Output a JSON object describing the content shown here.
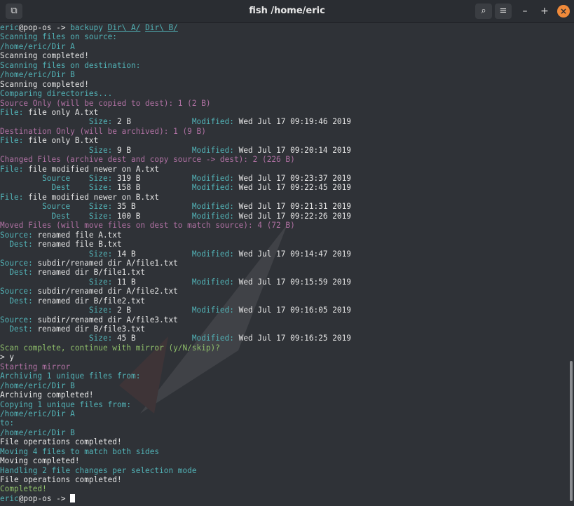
{
  "window": {
    "title": "fish /home/eric",
    "buttons": {
      "new_tab": "⧉",
      "search": "⌕",
      "menu": "≡",
      "minimize": "–",
      "maximize": "+",
      "close": "×"
    }
  },
  "terminal": {
    "lines": [
      [
        [
          "eric",
          "c"
        ],
        [
          "@pop-os ",
          "t"
        ],
        [
          "-> ",
          "t"
        ],
        [
          "backupy ",
          "c"
        ],
        [
          "Dir\\ A/",
          "cu"
        ],
        [
          " ",
          "t"
        ],
        [
          "Dir\\ B/",
          "cu"
        ]
      ],
      [
        [
          "Scanning files on source:",
          "c"
        ]
      ],
      [
        [
          "/home/eric/Dir A",
          "c"
        ]
      ],
      [
        [
          "Scanning completed!",
          "t"
        ]
      ],
      [
        [
          "Scanning files on destination:",
          "c"
        ]
      ],
      [
        [
          "/home/eric/Dir B",
          "c"
        ]
      ],
      [
        [
          "Scanning completed!",
          "t"
        ]
      ],
      [
        [
          "Comparing directories...",
          "c"
        ]
      ],
      [
        [
          "Source Only (will be copied to dest): 1 (2 B)",
          "m"
        ]
      ],
      [
        [
          "File: ",
          "c"
        ],
        [
          "file only A.txt",
          "t"
        ]
      ],
      [
        [
          "                   ",
          "t"
        ],
        [
          "Size: ",
          "c"
        ],
        [
          "2 B             ",
          "t"
        ],
        [
          "Modified: ",
          "c"
        ],
        [
          "Wed Jul 17 09:19:46 2019",
          "t"
        ]
      ],
      [
        [
          "Destination Only (will be archived): 1 (9 B)",
          "m"
        ]
      ],
      [
        [
          "File: ",
          "c"
        ],
        [
          "file only B.txt",
          "t"
        ]
      ],
      [
        [
          "                   ",
          "t"
        ],
        [
          "Size: ",
          "c"
        ],
        [
          "9 B             ",
          "t"
        ],
        [
          "Modified: ",
          "c"
        ],
        [
          "Wed Jul 17 09:20:14 2019",
          "t"
        ]
      ],
      [
        [
          "Changed Files (archive dest and copy source -> dest): 2 (226 B)",
          "m"
        ]
      ],
      [
        [
          "File: ",
          "c"
        ],
        [
          "file modified newer on A.txt",
          "t"
        ]
      ],
      [
        [
          "         Source    ",
          "c"
        ],
        [
          "Size: ",
          "c"
        ],
        [
          "319 B           ",
          "t"
        ],
        [
          "Modified: ",
          "c"
        ],
        [
          "Wed Jul 17 09:23:37 2019",
          "t"
        ]
      ],
      [
        [
          "           Dest    ",
          "c"
        ],
        [
          "Size: ",
          "c"
        ],
        [
          "158 B           ",
          "t"
        ],
        [
          "Modified: ",
          "c"
        ],
        [
          "Wed Jul 17 09:22:45 2019",
          "t"
        ]
      ],
      [
        [
          "File: ",
          "c"
        ],
        [
          "file modified newer on B.txt",
          "t"
        ]
      ],
      [
        [
          "         Source    ",
          "c"
        ],
        [
          "Size: ",
          "c"
        ],
        [
          "35 B            ",
          "t"
        ],
        [
          "Modified: ",
          "c"
        ],
        [
          "Wed Jul 17 09:21:31 2019",
          "t"
        ]
      ],
      [
        [
          "           Dest    ",
          "c"
        ],
        [
          "Size: ",
          "c"
        ],
        [
          "100 B           ",
          "t"
        ],
        [
          "Modified: ",
          "c"
        ],
        [
          "Wed Jul 17 09:22:26 2019",
          "t"
        ]
      ],
      [
        [
          "Moved Files (will move files on dest to match source): 4 (72 B)",
          "m"
        ]
      ],
      [
        [
          "Source: ",
          "c"
        ],
        [
          "renamed file A.txt",
          "t"
        ]
      ],
      [
        [
          "  Dest: ",
          "c"
        ],
        [
          "renamed file B.txt",
          "t"
        ]
      ],
      [
        [
          "                   ",
          "t"
        ],
        [
          "Size: ",
          "c"
        ],
        [
          "14 B            ",
          "t"
        ],
        [
          "Modified: ",
          "c"
        ],
        [
          "Wed Jul 17 09:14:47 2019",
          "t"
        ]
      ],
      [
        [
          "Source: ",
          "c"
        ],
        [
          "subdir/renamed dir A/file1.txt",
          "t"
        ]
      ],
      [
        [
          "  Dest: ",
          "c"
        ],
        [
          "renamed dir B/file1.txt",
          "t"
        ]
      ],
      [
        [
          "                   ",
          "t"
        ],
        [
          "Size: ",
          "c"
        ],
        [
          "11 B            ",
          "t"
        ],
        [
          "Modified: ",
          "c"
        ],
        [
          "Wed Jul 17 09:15:59 2019",
          "t"
        ]
      ],
      [
        [
          "Source: ",
          "c"
        ],
        [
          "subdir/renamed dir A/file2.txt",
          "t"
        ]
      ],
      [
        [
          "  Dest: ",
          "c"
        ],
        [
          "renamed dir B/file2.txt",
          "t"
        ]
      ],
      [
        [
          "                   ",
          "t"
        ],
        [
          "Size: ",
          "c"
        ],
        [
          "2 B             ",
          "t"
        ],
        [
          "Modified: ",
          "c"
        ],
        [
          "Wed Jul 17 09:16:05 2019",
          "t"
        ]
      ],
      [
        [
          "Source: ",
          "c"
        ],
        [
          "subdir/renamed dir A/file3.txt",
          "t"
        ]
      ],
      [
        [
          "  Dest: ",
          "c"
        ],
        [
          "renamed dir B/file3.txt",
          "t"
        ]
      ],
      [
        [
          "                   ",
          "t"
        ],
        [
          "Size: ",
          "c"
        ],
        [
          "45 B            ",
          "t"
        ],
        [
          "Modified: ",
          "c"
        ],
        [
          "Wed Jul 17 09:16:25 2019",
          "t"
        ]
      ],
      [
        [
          "Scan complete, continue with mirror (y/N/skip)?",
          "g"
        ]
      ],
      [
        [
          "> y",
          "t"
        ]
      ],
      [
        [
          "Starting mirror",
          "m"
        ]
      ],
      [
        [
          "Archiving 1 unique files from:",
          "c"
        ]
      ],
      [
        [
          "/home/eric/Dir B",
          "c"
        ]
      ],
      [
        [
          "Archiving completed!",
          "t"
        ]
      ],
      [
        [
          "Copying 1 unique files from:",
          "c"
        ]
      ],
      [
        [
          "/home/eric/Dir A",
          "c"
        ]
      ],
      [
        [
          "to:",
          "c"
        ]
      ],
      [
        [
          "/home/eric/Dir B",
          "c"
        ]
      ],
      [
        [
          "File operations completed!",
          "t"
        ]
      ],
      [
        [
          "Moving 4 files to match both sides",
          "c"
        ]
      ],
      [
        [
          "Moving completed!",
          "t"
        ]
      ],
      [
        [
          "Handling 2 file changes per selection mode",
          "c"
        ]
      ],
      [
        [
          "File operations completed!",
          "t"
        ]
      ],
      [
        [
          "Completed!",
          "g"
        ]
      ],
      [
        [
          "eric",
          "c"
        ],
        [
          "@pop-os ",
          "t"
        ],
        [
          "-> ",
          "t"
        ],
        [
          "",
          "cursor"
        ]
      ]
    ]
  }
}
